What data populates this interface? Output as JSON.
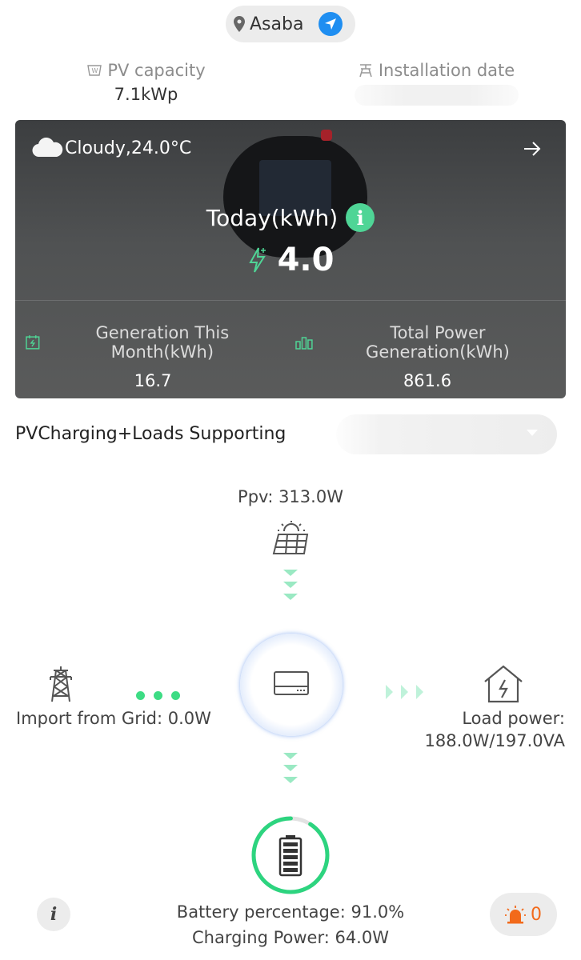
{
  "location": {
    "city": "Asaba"
  },
  "stats": {
    "pv_capacity_label": "PV capacity",
    "pv_capacity_value": "7.1kWp",
    "installation_date_label": "Installation date"
  },
  "hero": {
    "weather": "Cloudy,24.0°C",
    "today_label": "Today(kWh)",
    "today_value": "4.0",
    "month_label": "Generation This Month(kWh)",
    "month_value": "16.7",
    "total_label": "Total Power Generation(kWh)",
    "total_value": "861.6"
  },
  "mode": {
    "label": "PVCharging+Loads Supporting"
  },
  "flow": {
    "ppv": "Ppv: 313.0W",
    "grid": "Import from Grid: 0.0W",
    "load_line1": "Load power:",
    "load_line2": "188.0W/197.0VA",
    "battery_line1": "Battery percentage: 91.0%",
    "charging_line2": "Charging Power: 64.0W",
    "battery_percent": 91.0
  },
  "footer": {
    "alarm_count": "0"
  },
  "colors": {
    "accent_green": "#3ddc84",
    "accent_blue": "#1f8ef1",
    "alarm_orange": "#f26a1b"
  }
}
